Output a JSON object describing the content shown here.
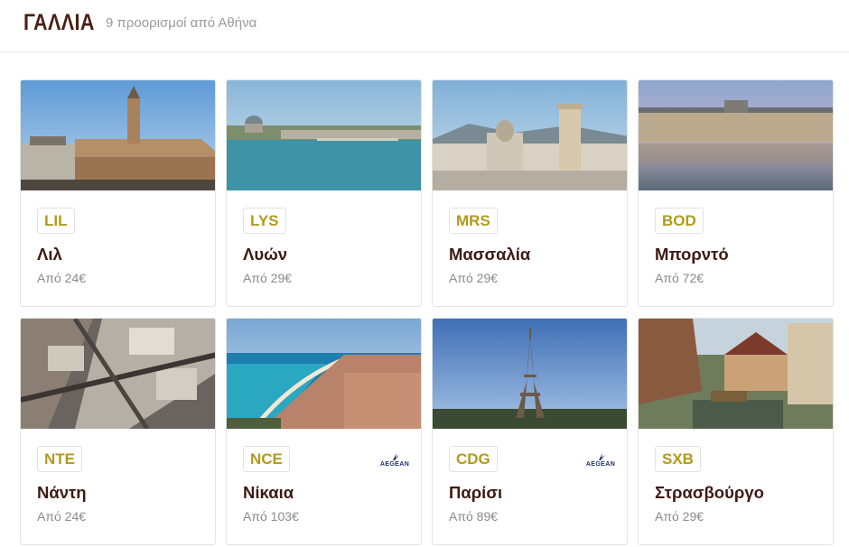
{
  "header": {
    "title": "ΓΑΛΛΙΑ",
    "subtitle": "9 προορισμοί από Αθήνα"
  },
  "destinations": [
    {
      "code": "LIL",
      "city": "Λιλ",
      "price": "Από 24€",
      "airline": ""
    },
    {
      "code": "LYS",
      "city": "Λυών",
      "price": "Από 29€",
      "airline": ""
    },
    {
      "code": "MRS",
      "city": "Μασσαλία",
      "price": "Από 29€",
      "airline": ""
    },
    {
      "code": "BOD",
      "city": "Μπορντό",
      "price": "Από 72€",
      "airline": ""
    },
    {
      "code": "NTE",
      "city": "Νάντη",
      "price": "Από 24€",
      "airline": ""
    },
    {
      "code": "NCE",
      "city": "Νίκαια",
      "price": "Από 103€",
      "airline": "AEGEAN"
    },
    {
      "code": "CDG",
      "city": "Παρίσι",
      "price": "Από 89€",
      "airline": "AEGEAN"
    },
    {
      "code": "SXB",
      "city": "Στρασβούργο",
      "price": "Από 29€",
      "airline": ""
    }
  ],
  "colors": {
    "title": "#4a1f17",
    "code": "#b29a1c",
    "airline": "#1c2f6e"
  }
}
